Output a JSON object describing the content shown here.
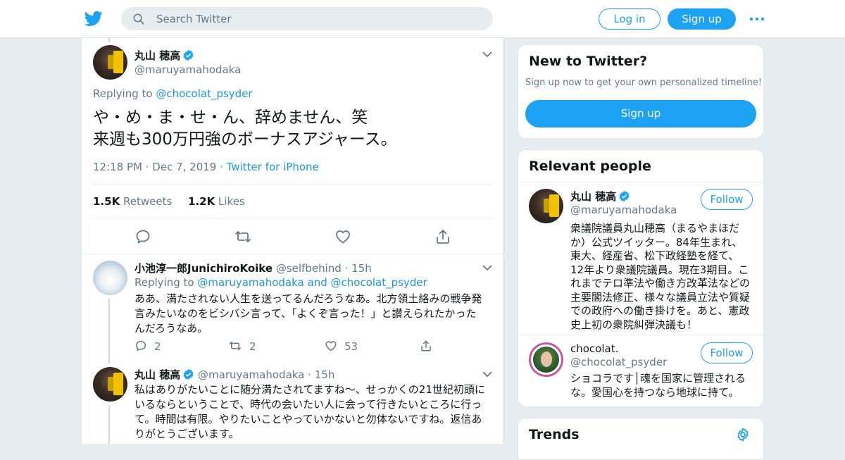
{
  "header": {
    "logo_icon": "twitter-bird-icon",
    "search_placeholder": "Search Twitter",
    "login_label": "Log in",
    "signup_label": "Sign up",
    "more_icon": "more-dots-icon",
    "accent": "#1da1f2"
  },
  "main_tweet": {
    "name": "丸山 穂高",
    "handle": "@maruyamahodaka",
    "replying_prefix": "Replying to",
    "replying_to": "@chocolat_psyder",
    "text_line1": "や・め・ま・せ・ん、辞めません、笑",
    "text_line2": "来週も300万円強のボーナスアジャース。",
    "time": "12:18 PM",
    "date": "Dec 7, 2019",
    "source": "Twitter for iPhone",
    "retweets_count": "1.5K",
    "retweets_label": "Retweets",
    "likes_count": "1.2K",
    "likes_label": "Likes"
  },
  "replies": [
    {
      "name": "小池淳一郎JunichiroKoike",
      "handle": "@selfbehind",
      "age": "15h",
      "replying_prefix": "Replying to",
      "replying_to_1": "@maruyamahodaka",
      "replying_and": "and",
      "replying_to_2": "@chocolat_psyder",
      "text": "ああ、満たされない人生を送ってるんだろうなあ。北方領土絡みの戦争発言みたいなのをビシバシ言って、「よくぞ言った！」と讃えられたかったんだろうなあ。",
      "replies_count": "2",
      "retweets_count": "2",
      "likes_count": "53"
    },
    {
      "name": "丸山 穂高",
      "handle": "@maruyamahodaka",
      "age": "15h",
      "text": "私はありがたいことに随分満たされてますね〜、せっかくの21世紀初頭にいるならということで、時代の会いたい人に会って行きたいところに行って。時間は有限。やりたいことやっていかないと勿体ないですね。返信ありがとうございます。"
    }
  ],
  "sidebar": {
    "new_title": "New to Twitter?",
    "new_sub": "Sign up now to get your own personalized timeline!",
    "new_signup_label": "Sign up",
    "relevant_title": "Relevant people",
    "people": [
      {
        "name": "丸山 穂高",
        "handle": "@maruyamahodaka",
        "follow_label": "Follow",
        "bio": "衆議院議員丸山穂高（まるやまほだか）公式ツイッター。84年生まれ、東大、経産省、松下政経塾を経て、12年より衆議院議員。現在3期目。これまでテロ準法や働き方改革法などの主要閣法修正、様々な議員立法や質疑での政府への働き掛けを。あと、憲政史上初の衆院糾弾決議も！"
      },
      {
        "name": "chocolat.",
        "handle": "@chocolat_psyder",
        "follow_label": "Follow",
        "bio": "ショコラです│魂を国家に管理されるな。愛国心を持つなら地球に持て。"
      }
    ],
    "trends_title": "Trends",
    "trends_icon": "settings-gear-icon"
  }
}
